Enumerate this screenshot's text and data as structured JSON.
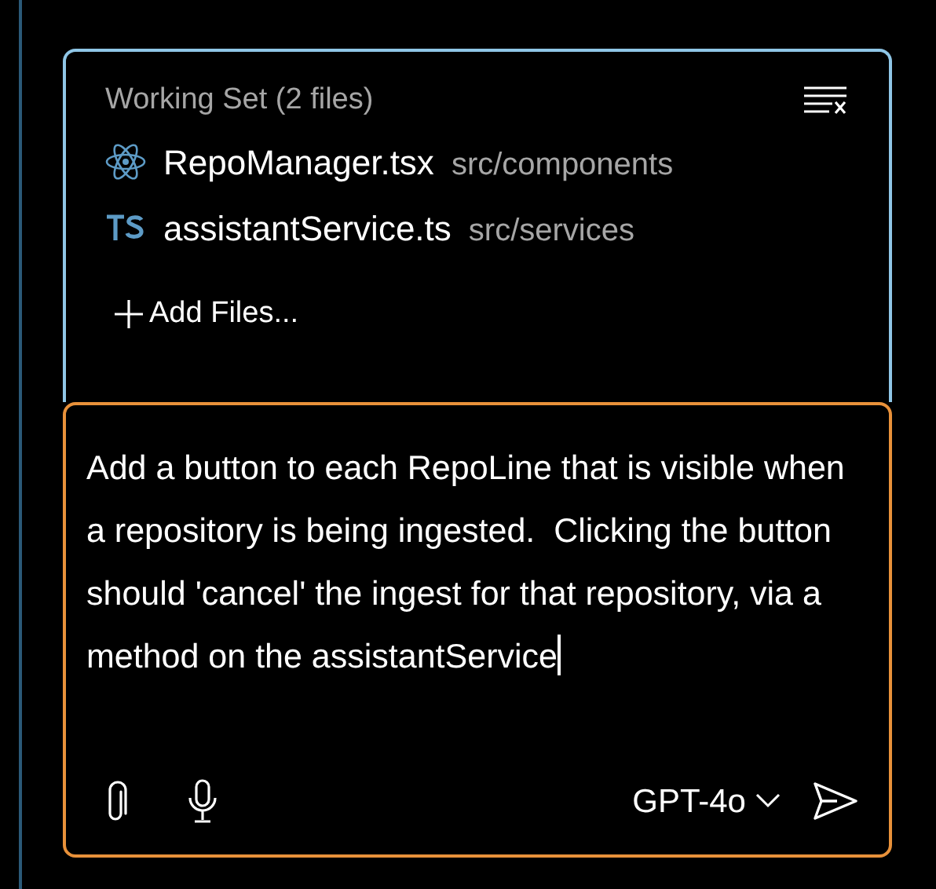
{
  "working_set": {
    "title": "Working Set (2 files)",
    "files": [
      {
        "kind": "react",
        "name": "RepoManager.tsx",
        "path": "src/components"
      },
      {
        "kind": "ts",
        "name": "assistantService.ts",
        "path": "src/services"
      }
    ],
    "add_files": "Add Files..."
  },
  "message": {
    "value": "Add a button to each RepoLine that is visible when a repository is being ingested.  Clicking the button should 'cancel' the ingest for that repository, via a method on the assistantService",
    "focused": true
  },
  "model": {
    "label": "GPT-4o"
  }
}
